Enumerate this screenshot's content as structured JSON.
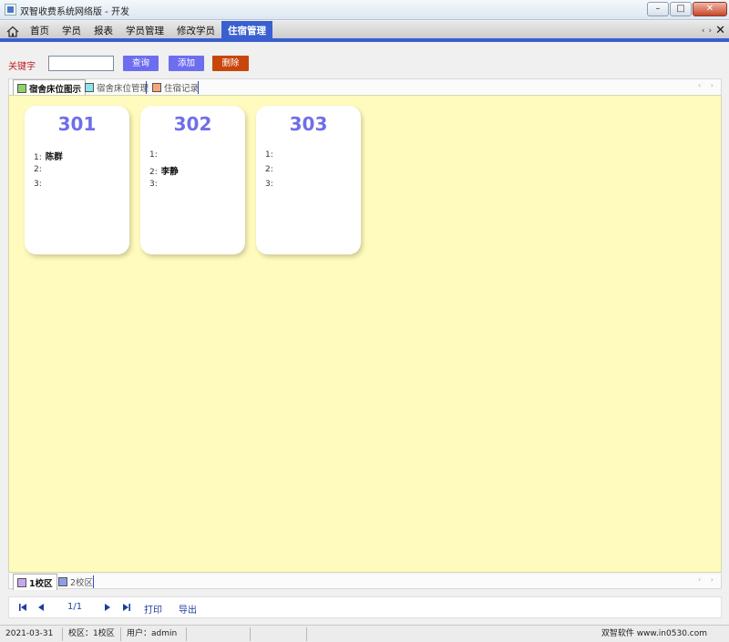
{
  "window": {
    "title": "双智收费系统网络版 - 开发",
    "btn_min": "–",
    "btn_max": "□",
    "btn_close": "✕"
  },
  "menu": {
    "items": [
      "首页",
      "学员",
      "报表",
      "学员管理",
      "修改学员",
      "住宿管理"
    ],
    "active_index": 5,
    "nav_prev": "‹",
    "nav_next": "›",
    "close": "✕"
  },
  "toolbar": {
    "keyword_label": "关键字",
    "keyword_value": "",
    "query_label": "查询",
    "add_label": "添加",
    "delete_label": "删除"
  },
  "top_tabs": [
    {
      "label": "宿舍床位图示",
      "color": "#8ed16a",
      "active": true
    },
    {
      "label": "宿舍床位管理",
      "color": "#8fe4ea",
      "active": false
    },
    {
      "label": "住宿记录",
      "color": "#f4a77a",
      "active": false
    }
  ],
  "rooms": [
    {
      "number": "301",
      "beds": [
        {
          "index": "1:",
          "name": "陈群"
        },
        {
          "index": "2:",
          "name": ""
        },
        {
          "index": "3:",
          "name": ""
        }
      ]
    },
    {
      "number": "302",
      "beds": [
        {
          "index": "1:",
          "name": ""
        },
        {
          "index": "2:",
          "name": "李静"
        },
        {
          "index": "3:",
          "name": ""
        }
      ]
    },
    {
      "number": "303",
      "beds": [
        {
          "index": "1:",
          "name": ""
        },
        {
          "index": "2:",
          "name": ""
        },
        {
          "index": "3:",
          "name": ""
        }
      ]
    }
  ],
  "bottom_tabs": [
    {
      "label": "1校区",
      "color": "#c6a8f0",
      "active": true
    },
    {
      "label": "2校区",
      "color": "#8c9ee6",
      "active": false
    }
  ],
  "pager": {
    "page_text": "1/1",
    "print_label": "打印",
    "export_label": "导出"
  },
  "status": {
    "date": "2021-03-31",
    "campus": "校区：1校区",
    "user": "用户：admin",
    "company": "双智软件 www.in0530.com"
  },
  "colors": {
    "accent": "#3a5fd0",
    "content_bg": "#fffbbe",
    "room_number": "#6f6fe8",
    "delete_btn": "#c8460c",
    "action_btn": "#6d6df0"
  }
}
